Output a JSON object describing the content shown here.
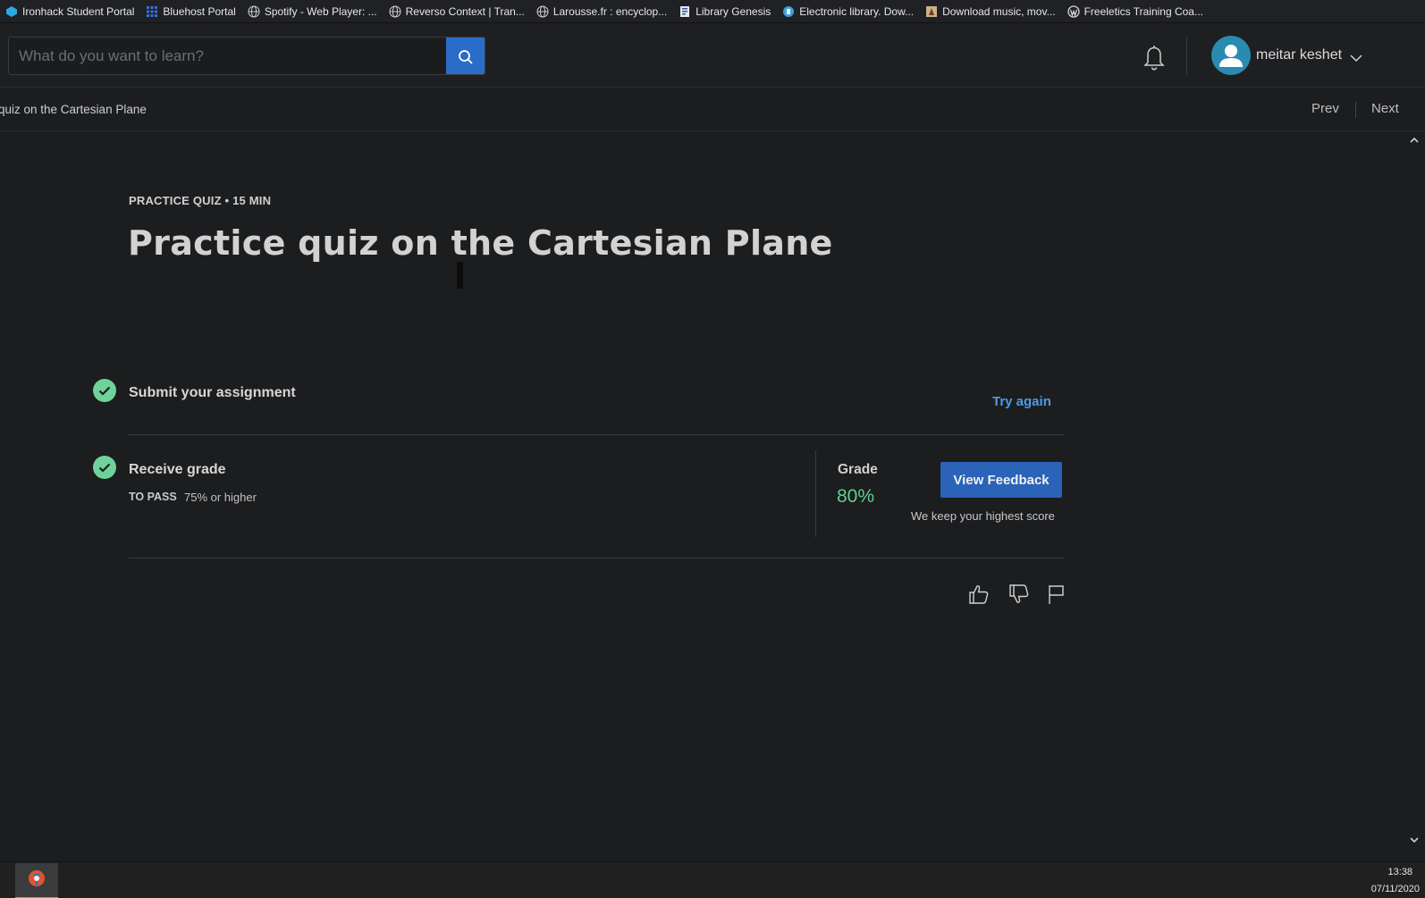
{
  "bookmarks": [
    {
      "label": "Ironhack Student Portal",
      "icon": "ironhack-icon"
    },
    {
      "label": "Bluehost Portal",
      "icon": "bluehost-grid-icon"
    },
    {
      "label": "Spotify - Web Player: ...",
      "icon": "globe-icon"
    },
    {
      "label": "Reverso Context | Tran...",
      "icon": "globe-icon"
    },
    {
      "label": "Larousse.fr : encyclop...",
      "icon": "globe-icon"
    },
    {
      "label": "Library Genesis",
      "icon": "book-icon"
    },
    {
      "label": "Electronic library. Dow...",
      "icon": "zlibrary-icon"
    },
    {
      "label": "Download music, mov...",
      "icon": "torrent-icon"
    },
    {
      "label": "Freeletics Training Coa...",
      "icon": "wordpress-icon"
    }
  ],
  "header": {
    "search_placeholder": "What do you want to learn?",
    "username": "meitar keshet"
  },
  "subnav": {
    "breadcrumb": "quiz on the Cartesian Plane",
    "prev": "Prev",
    "next": "Next"
  },
  "quiz": {
    "kicker": "PRACTICE QUIZ • 15 MIN",
    "title": "Practice quiz on the Cartesian Plane",
    "submit_label": "Submit your assignment",
    "try_again": "Try again",
    "receive_label": "Receive grade",
    "to_pass_label": "TO PASS",
    "to_pass_value": "75% or higher",
    "grade_label": "Grade",
    "grade_value": "80%",
    "view_feedback": "View Feedback",
    "keep_note": "We keep your highest score"
  },
  "taskbar": {
    "time": "13:38",
    "date": "07/11/2020"
  },
  "colors": {
    "accent_blue": "#2a63b8",
    "link_blue": "#4d9be9",
    "success_green": "#6fd29a",
    "grade_green": "#5fd08a"
  }
}
